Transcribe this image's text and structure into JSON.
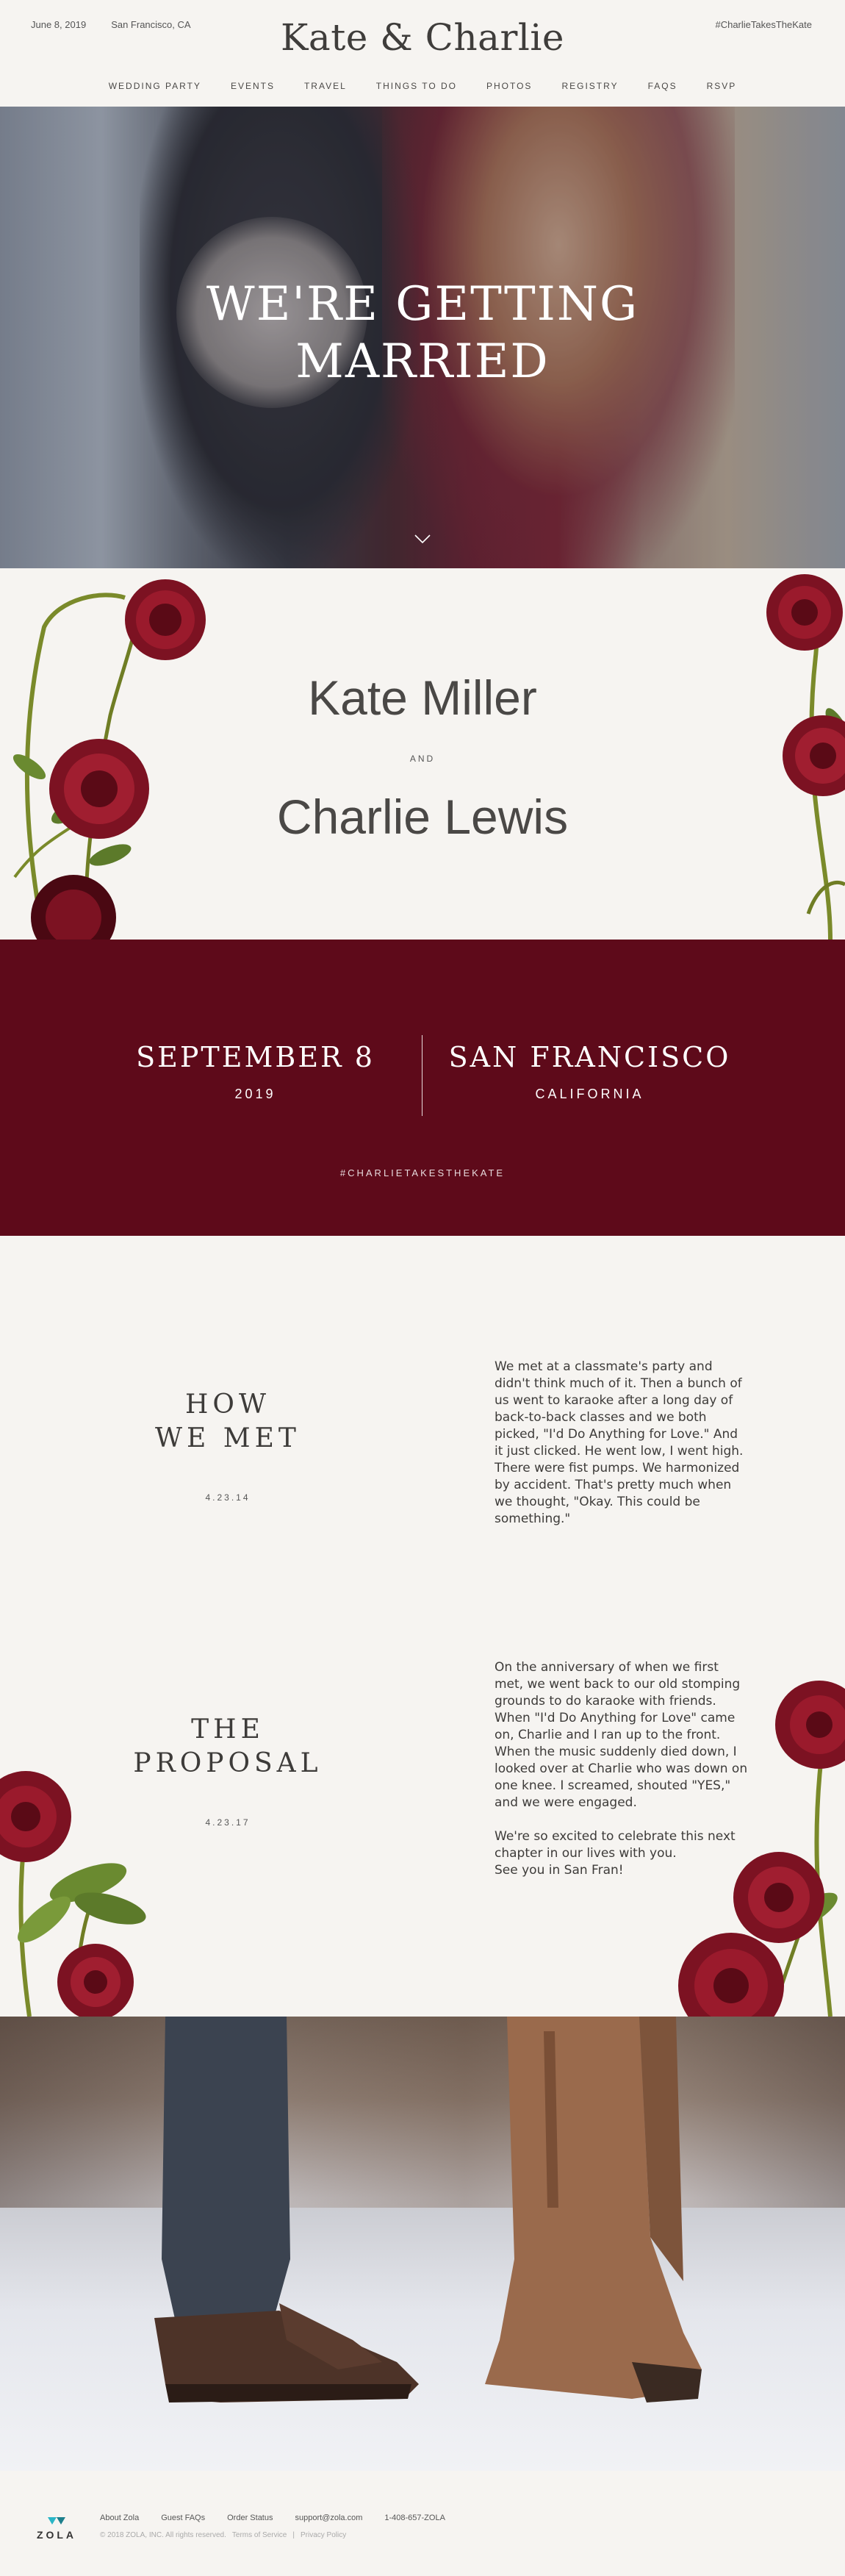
{
  "header": {
    "date": "June 8, 2019",
    "location": "San Francisco, CA",
    "title": "Kate & Charlie",
    "hashtag": "#CharlieTakesTheKate",
    "nav": [
      "WEDDING PARTY",
      "EVENTS",
      "TRAVEL",
      "THINGS TO DO",
      "PHOTOS",
      "REGISTRY",
      "FAQS",
      "RSVP"
    ]
  },
  "hero": {
    "title_line1": "WE'RE GETTING",
    "title_line2": "MARRIED",
    "scroll_icon": "chevron-down-icon"
  },
  "couple": {
    "name1": "Kate Miller",
    "and": "AND",
    "name2": "Charlie Lewis"
  },
  "details": {
    "date": "SEPTEMBER 8",
    "year": "2019",
    "city": "SAN FRANCISCO",
    "state": "CALIFORNIA",
    "hashtag": "#CHARLIETAKESTHEKATE",
    "background": "#5e0a1a"
  },
  "story": {
    "how_we_met": {
      "heading_line1": "HOW",
      "heading_line2": "WE MET",
      "date": "4.23.14",
      "text": "We met at a classmate's party and didn't think much of it. Then a bunch of us went to karaoke after a long day of back-to-back classes and we both picked, \"I'd Do Anything for Love.\" And it just clicked. He went low, I went high. There were fist pumps. We harmonized by accident. That's pretty much when we thought, \"Okay. This could be something.\""
    },
    "proposal": {
      "heading_line1": "THE",
      "heading_line2": "PROPOSAL",
      "date": "4.23.17",
      "text": "On the anniversary of when we first met, we went back to our old stomping grounds to do karaoke with friends. When \"I'd Do Anything for Love\" came on, Charlie and I ran up to the front. When the music suddenly died down, I looked over at Charlie who was down on one knee. I screamed, shouted \"YES,\" and we were engaged.",
      "closing1": "We're so excited to celebrate this next chapter in our lives with you.",
      "closing2": "See you in San Fran!"
    }
  },
  "footer": {
    "brand": "ZOLA",
    "links": [
      "About Zola",
      "Guest FAQs",
      "Order Status",
      "support@zola.com",
      "1-408-657-ZOLA"
    ],
    "copyright": "© 2018 ZOLA, INC. All rights reserved.",
    "terms": "Terms of Service",
    "separator": "|",
    "privacy": "Privacy Policy"
  }
}
